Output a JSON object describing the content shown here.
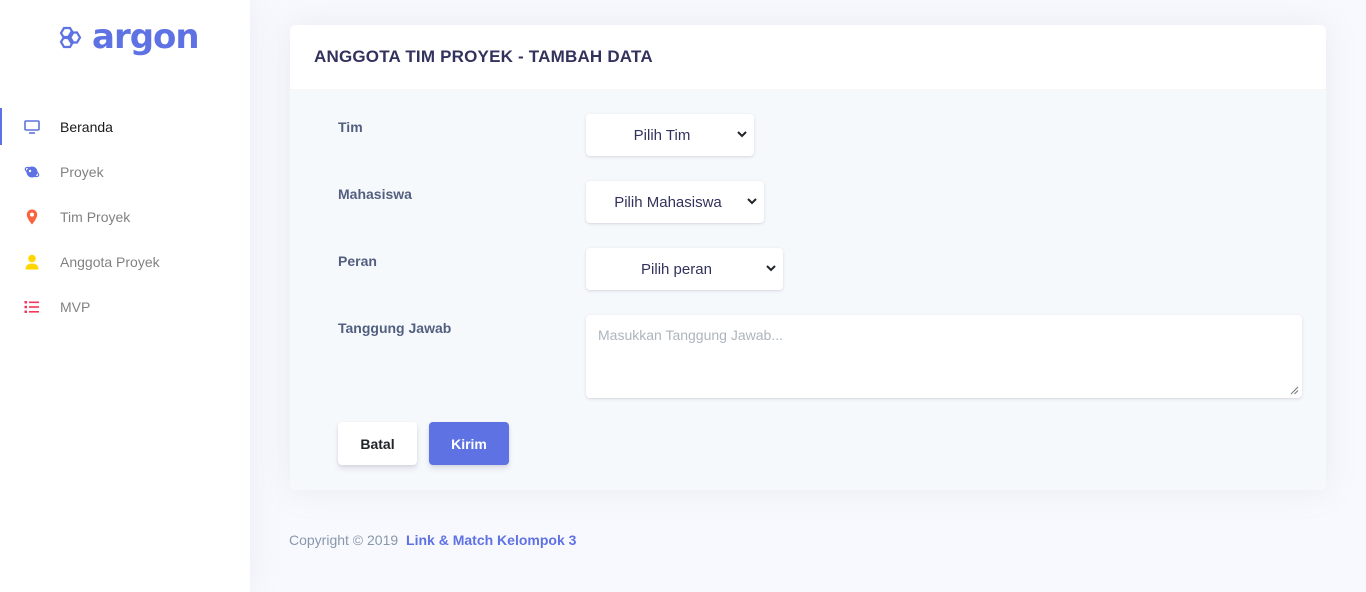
{
  "brand": {
    "name": "argon",
    "color": "#5e72e4"
  },
  "sidebar": {
    "items": [
      {
        "label": "Beranda",
        "icon": "tv-icon",
        "color": "#5e72e4",
        "active": true
      },
      {
        "label": "Proyek",
        "icon": "planet-icon",
        "color": "#5e72e4",
        "active": false
      },
      {
        "label": "Tim Proyek",
        "icon": "pin-icon",
        "color": "#fb6340",
        "active": false
      },
      {
        "label": "Anggota Proyek",
        "icon": "user-icon",
        "color": "#ffd600",
        "active": false
      },
      {
        "label": "MVP",
        "icon": "list-icon",
        "color": "#f5365c",
        "active": false
      }
    ]
  },
  "card": {
    "title": "ANGGOTA TIM PROYEK - TAMBAH DATA",
    "fields": {
      "tim": {
        "label": "Tim",
        "value": "Pilih Tim"
      },
      "mahasiswa": {
        "label": "Mahasiswa",
        "value": "Pilih Mahasiswa"
      },
      "peran": {
        "label": "Peran",
        "value": "Pilih peran"
      },
      "tanggung_jawab": {
        "label": "Tanggung Jawab",
        "placeholder": "Masukkan Tanggung Jawab..."
      }
    },
    "buttons": {
      "cancel": "Batal",
      "submit": "Kirim"
    }
  },
  "footer": {
    "copyright": "Copyright © 2019",
    "link_text": "Link & Match Kelompok 3"
  }
}
